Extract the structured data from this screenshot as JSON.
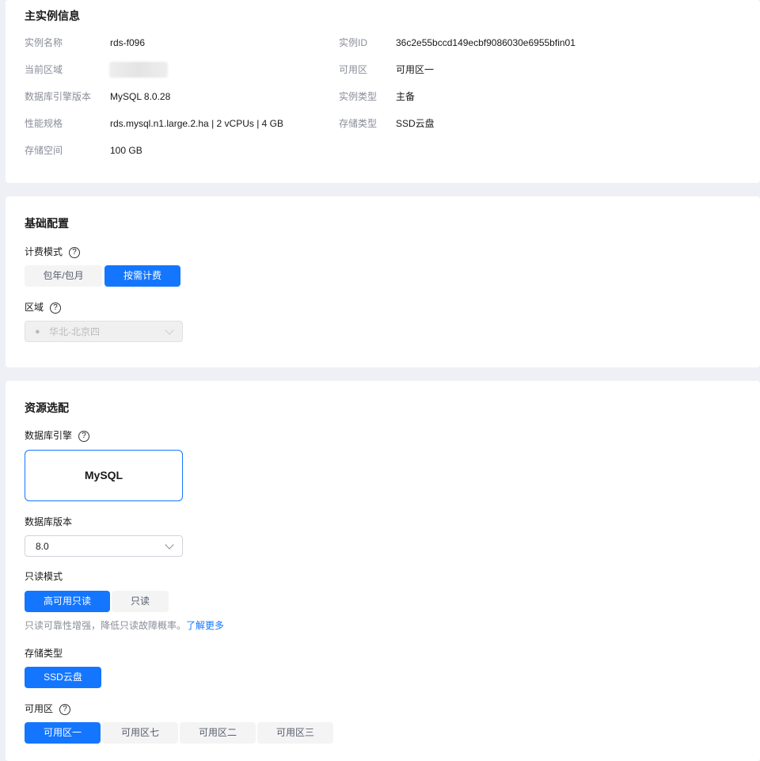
{
  "main_info": {
    "title": "主实例信息",
    "rows": [
      {
        "label": "实例名称",
        "value": "rds-f096"
      },
      {
        "label": "当前区域",
        "value": ""
      },
      {
        "label": "数据库引擎版本",
        "value": "MySQL 8.0.28"
      },
      {
        "label": "性能规格",
        "value": "rds.mysql.n1.large.2.ha | 2 vCPUs | 4 GB"
      },
      {
        "label": "存储空间",
        "value": "100 GB"
      }
    ],
    "rows_right": [
      {
        "label": "实例ID",
        "value": "36c2e55bccd149ecbf9086030e6955bfin01"
      },
      {
        "label": "可用区",
        "value": "可用区一"
      },
      {
        "label": "实例类型",
        "value": "主备"
      },
      {
        "label": "存储类型",
        "value": "SSD云盘"
      }
    ]
  },
  "basic": {
    "title": "基础配置",
    "billing_label": "计费模式",
    "billing_options": [
      "包年/包月",
      "按需计费"
    ],
    "region_label": "区域",
    "region_value": "华北-北京四",
    "help": "?"
  },
  "resource": {
    "title": "资源选配",
    "engine_label": "数据库引擎",
    "engine_value": "MySQL",
    "version_label": "数据库版本",
    "version_value": "8.0",
    "readonly_label": "只读模式",
    "readonly_options": [
      "高可用只读",
      "只读"
    ],
    "readonly_hint": "只读可靠性增强，降低只读故障概率。",
    "learn_more": "了解更多",
    "storage_label": "存储类型",
    "storage_options": [
      "SSD云盘"
    ],
    "az_label": "可用区",
    "az_options": [
      "可用区一",
      "可用区七",
      "可用区二",
      "可用区三"
    ]
  },
  "colors": {
    "accent": "#1476ff"
  }
}
